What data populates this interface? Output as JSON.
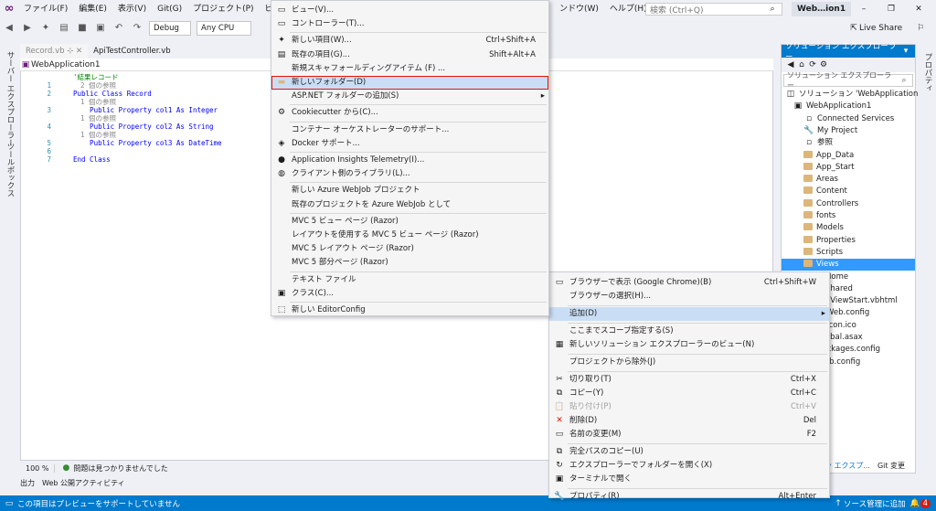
{
  "menubar": {
    "items": [
      "ファイル(F)",
      "編集(E)",
      "表示(V)",
      "Git(G)",
      "プロジェクト(P)",
      "ビル"
    ],
    "right_items": [
      "ンドウ(W)",
      "ヘルプ(H)"
    ],
    "search_placeholder": "検索 (Ctrl+Q)",
    "window_title": "Web…ion1",
    "live_share": "Live Share"
  },
  "toolbar": {
    "config": "Debug",
    "platform": "Any CPU"
  },
  "side_strip": {
    "items": [
      "サーバー エクスプローラー",
      "ツールボックス"
    ]
  },
  "editor": {
    "tabs": [
      "Record.vb",
      "ApiTestController.vb"
    ],
    "nav_project": "WebApplication1",
    "lines": [
      {
        "n": "",
        "text": "'結果レコード",
        "kind": "comment"
      },
      {
        "n": "1",
        "text": "2 個の参照",
        "kind": "lens"
      },
      {
        "n": "2",
        "text": "Public Class Record",
        "kind": "code"
      },
      {
        "n": "",
        "text": "1 個の参照",
        "kind": "lens"
      },
      {
        "n": "3",
        "text": "    Public Property col1 As Integer",
        "kind": "code"
      },
      {
        "n": "",
        "text": "1 個の参照",
        "kind": "lens"
      },
      {
        "n": "4",
        "text": "    Public Property col2 As String",
        "kind": "code"
      },
      {
        "n": "",
        "text": "1 個の参照",
        "kind": "lens"
      },
      {
        "n": "5",
        "text": "    Public Property col3 As DateTime",
        "kind": "code"
      },
      {
        "n": "6",
        "text": "",
        "kind": "code"
      },
      {
        "n": "7",
        "text": "End Class",
        "kind": "code"
      }
    ],
    "zoom": "100 %",
    "status": "問題は見つかりませんでした"
  },
  "output": {
    "tabs": [
      "出力",
      "Web 公開アクティビティ"
    ]
  },
  "statusbar": {
    "left": "この項目はプレビューをサポートしていません",
    "right": "ソース管理に追加",
    "badge": "4"
  },
  "solution_explorer": {
    "title": "ソリューション エクスプローラー",
    "search": "ソリューション エクスプローラー",
    "nodes": [
      {
        "label": "ソリューション 'WebApplication",
        "icon": "solution"
      },
      {
        "label": "WebApplication1",
        "icon": "project"
      },
      {
        "label": "Connected Services",
        "icon": "service"
      },
      {
        "label": "My Project",
        "icon": "wrench"
      },
      {
        "label": "参照",
        "icon": "ref"
      },
      {
        "label": "App_Data",
        "icon": "folder"
      },
      {
        "label": "App_Start",
        "icon": "folder"
      },
      {
        "label": "Areas",
        "icon": "folder"
      },
      {
        "label": "Content",
        "icon": "folder"
      },
      {
        "label": "Controllers",
        "icon": "folder"
      },
      {
        "label": "fonts",
        "icon": "folder"
      },
      {
        "label": "Models",
        "icon": "folder"
      },
      {
        "label": "Properties",
        "icon": "folder"
      },
      {
        "label": "Scripts",
        "icon": "folder"
      },
      {
        "label": "Views",
        "icon": "folder"
      },
      {
        "label": "Home",
        "icon": "folder"
      },
      {
        "label": "Shared",
        "icon": "folder"
      },
      {
        "label": "_ViewStart.vbhtml",
        "icon": "file"
      },
      {
        "label": "Web.config",
        "icon": "file"
      },
      {
        "label": "avicon.ico",
        "icon": "file"
      },
      {
        "label": "Global.asax",
        "icon": "file"
      },
      {
        "label": "packages.config",
        "icon": "file"
      },
      {
        "label": "Web.config",
        "icon": "file"
      }
    ],
    "bottom_tabs": [
      "ソン エクスプ...",
      "Git 変更"
    ]
  },
  "right_strip": {
    "label": "プロパティ"
  },
  "context_menu_main": {
    "items": [
      {
        "label": "追加(D)",
        "shortcut": "",
        "icon": "none"
      },
      {
        "label": "ここまでスコープ指定する(S)",
        "shortcut": "",
        "icon": "none"
      },
      {
        "label": "新しいソリューション エクスプローラーのビュー(N)",
        "shortcut": "",
        "icon": "window"
      },
      {
        "label": "プロジェクトから除外(J)",
        "shortcut": "",
        "icon": "none"
      },
      {
        "label": "切り取り(T)",
        "shortcut": "Ctrl+X",
        "icon": "scissors"
      },
      {
        "label": "コピー(Y)",
        "shortcut": "Ctrl+C",
        "icon": "copy"
      },
      {
        "label": "貼り付け(P)",
        "shortcut": "Ctrl+V",
        "icon": "paste"
      },
      {
        "label": "削除(D)",
        "shortcut": "Del",
        "icon": "delete"
      },
      {
        "label": "名前の変更(M)",
        "shortcut": "F2",
        "icon": "rename"
      },
      {
        "label": "完全パスのコピー(U)",
        "shortcut": "",
        "icon": "copy"
      },
      {
        "label": "エクスプローラーでフォルダーを開く(X)",
        "shortcut": "",
        "icon": "refresh"
      },
      {
        "label": "ターミナルで開く",
        "shortcut": "",
        "icon": "terminal"
      },
      {
        "label": "プロパティ(R)",
        "shortcut": "Alt+Enter",
        "icon": "wrench"
      }
    ],
    "top_items": [
      {
        "label": "ブラウザーで表示 (Google Chrome)(B)",
        "shortcut": "Ctrl+Shift+W"
      },
      {
        "label": "ブラウザーの選択(H)...",
        "shortcut": ""
      }
    ]
  },
  "context_menu_add": {
    "items": [
      {
        "label": "ビュー(V)...",
        "shortcut": ""
      },
      {
        "label": "コントローラー(T)...",
        "shortcut": ""
      },
      {
        "label": "新しい項目(W)...",
        "shortcut": "Ctrl+Shift+A"
      },
      {
        "label": "既存の項目(G)...",
        "shortcut": "Shift+Alt+A"
      },
      {
        "label": "新規スキャフォールディングアイテム (F) ...",
        "shortcut": ""
      },
      {
        "label": "新しいフォルダー(D)",
        "shortcut": ""
      },
      {
        "label": "ASP.NET フォルダーの追加(S)",
        "shortcut": ""
      },
      {
        "label": "Cookiecutter から(C)...",
        "shortcut": ""
      },
      {
        "label": "コンテナー オーケストレーターのサポート...",
        "shortcut": ""
      },
      {
        "label": "Docker サポート...",
        "shortcut": ""
      },
      {
        "label": "Application Insights Telemetry(I)...",
        "shortcut": ""
      },
      {
        "label": "クライアント側のライブラリ(L)...",
        "shortcut": ""
      },
      {
        "label": "新しい Azure WebJob プロジェクト",
        "shortcut": ""
      },
      {
        "label": "既存のプロジェクトを Azure WebJob として",
        "shortcut": ""
      },
      {
        "label": "MVC 5 ビュー ページ (Razor)",
        "shortcut": ""
      },
      {
        "label": "レイアウトを使用する MVC 5 ビュー ページ (Razor)",
        "shortcut": ""
      },
      {
        "label": "MVC 5 レイアウト ページ (Razor)",
        "shortcut": ""
      },
      {
        "label": "MVC 5 部分ページ (Razor)",
        "shortcut": ""
      },
      {
        "label": "テキスト ファイル",
        "shortcut": ""
      },
      {
        "label": "クラス(C)...",
        "shortcut": ""
      },
      {
        "label": "新しい EditorConfig",
        "shortcut": ""
      }
    ]
  },
  "colors": {
    "accent": "#007acc",
    "selection": "#3399ff",
    "highlight_box": "#e51400",
    "menu_hover": "#c9def5"
  }
}
